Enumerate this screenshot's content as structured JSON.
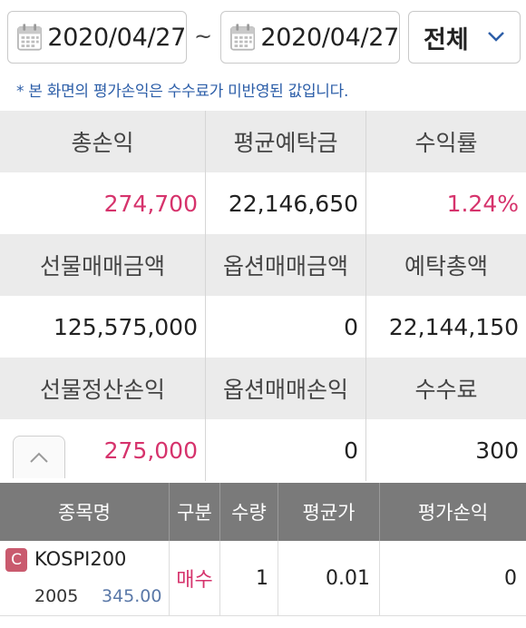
{
  "filter": {
    "start_date": "2020/04/27",
    "separator": "~",
    "end_date": "2020/04/27",
    "category": "전체",
    "note": "* 본 화면의 평가손익은 수수료가 미반영된 값입니다."
  },
  "summary": {
    "rows": [
      {
        "headers": [
          "총손익",
          "평균예탁금",
          "수익률"
        ],
        "values": [
          "274,700",
          "22,146,650",
          "1.24%"
        ]
      },
      {
        "headers": [
          "선물매매금액",
          "옵션매매금액",
          "예탁총액"
        ],
        "values": [
          "125,575,000",
          "0",
          "22,144,150"
        ]
      },
      {
        "headers": [
          "선물정산손익",
          "옵션매매손익",
          "수수료"
        ],
        "values": [
          "275,000",
          "0",
          "300"
        ]
      }
    ]
  },
  "positions": {
    "columns": [
      "종목명",
      "구분",
      "수량",
      "평균가",
      "평가손익"
    ],
    "rows": [
      {
        "badge": "C",
        "name": "KOSPI200",
        "code": "2005",
        "price": "345.00",
        "side": "매수",
        "qty": "1",
        "avg_price": "0.01",
        "pnl": "0"
      }
    ]
  },
  "colors": {
    "positive": "#d6336c",
    "note": "#2c5ea8",
    "list_header": "#7a7a7a"
  }
}
